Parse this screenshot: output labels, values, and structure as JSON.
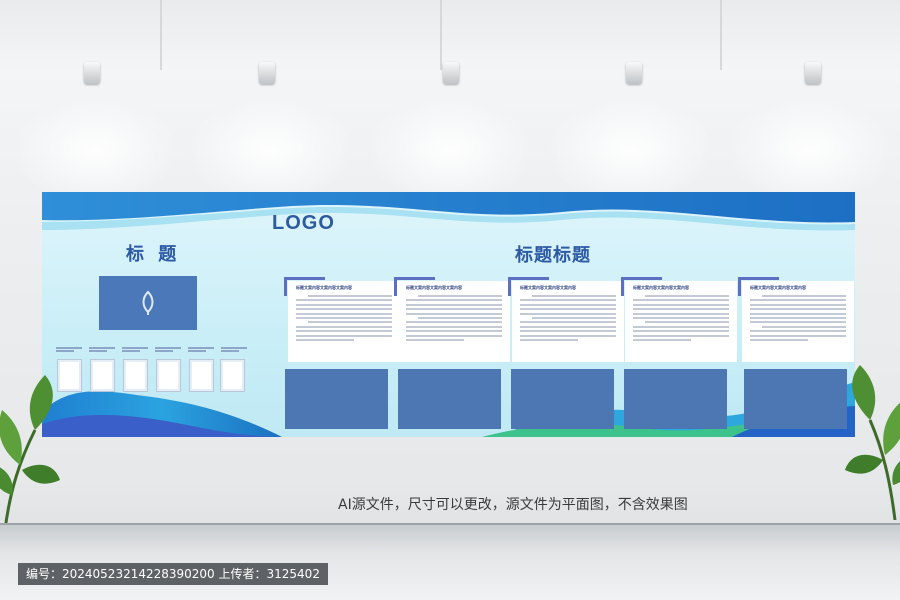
{
  "board": {
    "logo": "LOGO",
    "title_left": "标 题",
    "title_right": "标题标题",
    "cards": [
      {
        "title": "标题文案内容文案内容文案内容"
      },
      {
        "title": "标题文案内容文案内容文案内容"
      },
      {
        "title": "标题文案内容文案内容文案内容"
      },
      {
        "title": "标题文案内容文案内容文案内容"
      },
      {
        "title": "标题文案内容文案内容文案内容"
      }
    ]
  },
  "caption": "AI源文件，尺寸可以更改，源文件为平面图，不含效果图",
  "footer": "编号：20240523214228390200  上传者：3125402",
  "colors": {
    "accent": "#2c5aa5",
    "photo": "#4a78b8",
    "board_bg": "#c9eef7"
  }
}
